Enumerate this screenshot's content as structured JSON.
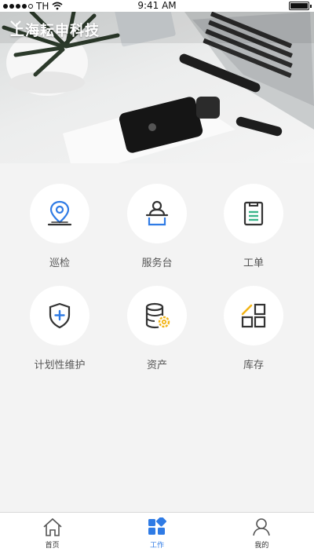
{
  "status_bar": {
    "carrier": "TH",
    "time": "9:41 AM",
    "icons": [
      "signal-dots-icon",
      "wifi-icon",
      "battery-icon"
    ]
  },
  "header": {
    "company_name": "上海耘申科技",
    "dropdown_icon": "chevron-down-icon"
  },
  "menu": {
    "items": [
      {
        "label": "巡检",
        "icon": "location-pin-icon"
      },
      {
        "label": "服务台",
        "icon": "service-desk-icon"
      },
      {
        "label": "工单",
        "icon": "clipboard-icon"
      },
      {
        "label": "计划性维护",
        "icon": "shield-plus-icon"
      },
      {
        "label": "资产",
        "icon": "database-gear-icon"
      },
      {
        "label": "库存",
        "icon": "inventory-grid-icon"
      }
    ]
  },
  "tab_bar": {
    "tabs": [
      {
        "label": "首页",
        "icon": "home-icon",
        "active": false
      },
      {
        "label": "工作",
        "icon": "grid-work-icon",
        "active": true
      },
      {
        "label": "我的",
        "icon": "user-icon",
        "active": false
      }
    ],
    "active_color": "#2f7be5"
  },
  "colors": {
    "accent_blue": "#2f7be5",
    "accent_green": "#3bb58a",
    "accent_yellow": "#f2b416",
    "background": "#f3f3f3"
  }
}
